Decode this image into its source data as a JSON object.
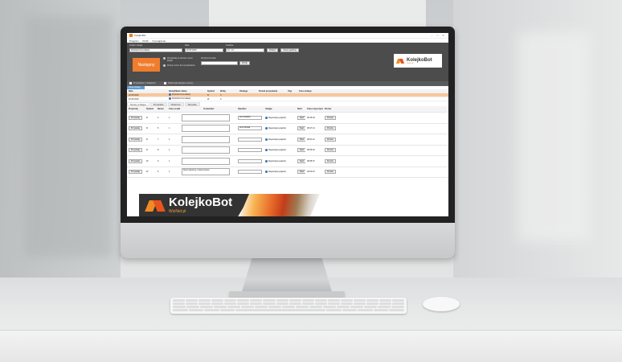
{
  "app": {
    "window_title": "KolejkoBot",
    "window_controls": [
      "–",
      "□",
      "✕"
    ],
    "menu": [
      "Program",
      "Profil",
      "O programie"
    ],
    "fields": [
      {
        "label": "Urząd / usługa",
        "value": "Wydział Komunikacji"
      },
      {
        "label": "Data",
        "value": "22.05.2019"
      },
      {
        "label": "Godzina",
        "value": "12 : 14"
      }
    ],
    "field_buttons": [
      "Pobierz",
      "Zmień godzinę"
    ],
    "next_button": "Następny",
    "options": [
      "Wyświetlaj na ekranie numer kolejki",
      "Drukuj numer bez wyświetlania"
    ],
    "send": {
      "label": "Wyślij komunikat",
      "button": "Wyślij"
    },
    "logo": {
      "name": "KolejkoBot",
      "sub": "WizNet.pl"
    },
    "checkboxes": [
      "Przywołanie z dźwiękiem",
      "Pokaż tylko aktywne numery"
    ],
    "top_section": "Okna obsługi",
    "top_columns": [
      "Data",
      "Identyfikator biletu",
      "Symbol",
      "Wołaj",
      "Obsługa",
      "Powód przywołania",
      "Użyj",
      "Czas obsługi"
    ],
    "top_rows": [
      {
        "date": "22.05.2019",
        "id": "Wydział Komunikacji",
        "symbol": "R",
        "count": "3",
        "sel": true
      },
      {
        "date": "22.05.2019",
        "id": "Wydział Komunikacji",
        "symbol": "W",
        "count": "0",
        "sel": false
      }
    ],
    "tabs": [
      "Numery w kolejce",
      "Przywołane",
      "Obsłużone",
      "Wszystkie"
    ],
    "list_columns": [
      "Przywołaj",
      "Symbol",
      "Numer",
      "Czas oczekiwania",
      "Komentarz",
      "Operator",
      "Usługa",
      "Start",
      "Czas rozpoczęcia",
      "Ponów"
    ],
    "list_rows": [
      {
        "call": "Przywołaj",
        "symbol": "R",
        "num": "4",
        "wait": "1",
        "comment": "",
        "operator": "Jan Kowalski",
        "service": "Rejestracja pojazdu",
        "start": "Start",
        "time": "08:45:03",
        "retry": "Ponów"
      },
      {
        "call": "Przywołaj",
        "symbol": "R",
        "num": "5",
        "wait": "1",
        "comment": "",
        "operator": "Anna Nowak",
        "service": "Rejestracja pojazdu",
        "start": "Start",
        "time": "08:47:21",
        "retry": "Ponów"
      },
      {
        "call": "Przywołaj",
        "symbol": "R",
        "num": "7",
        "wait": "1",
        "comment": "",
        "operator": "",
        "service": "Rejestracja pojazdu",
        "start": "Start",
        "time": "08:51:12",
        "retry": "Ponów"
      },
      {
        "call": "Przywołaj",
        "symbol": "R",
        "num": "8",
        "wait": "1",
        "comment": "",
        "operator": "",
        "service": "Rejestracja pojazdu",
        "start": "Start",
        "time": "08:55:40",
        "retry": "Ponów"
      },
      {
        "call": "Przywołaj",
        "symbol": "W",
        "num": "9",
        "wait": "1",
        "comment": "",
        "operator": "",
        "service": "Rejestracja pojazdu",
        "start": "Start",
        "time": "08:58:07",
        "retry": "Ponów"
      },
      {
        "call": "Przywołaj",
        "symbol": "W",
        "num": "6",
        "wait": "1",
        "comment": "Klient zgłosił się z dokumentami",
        "operator": "",
        "service": "Rejestracja pojazdu",
        "start": "Start",
        "time": "09:03:15",
        "retry": "Ponów"
      }
    ],
    "banner": {
      "name": "KolejkoBot",
      "sub": "WizNet.pl"
    },
    "accent": "#ef7d2d",
    "selected_row_color": "#f8c79a"
  }
}
